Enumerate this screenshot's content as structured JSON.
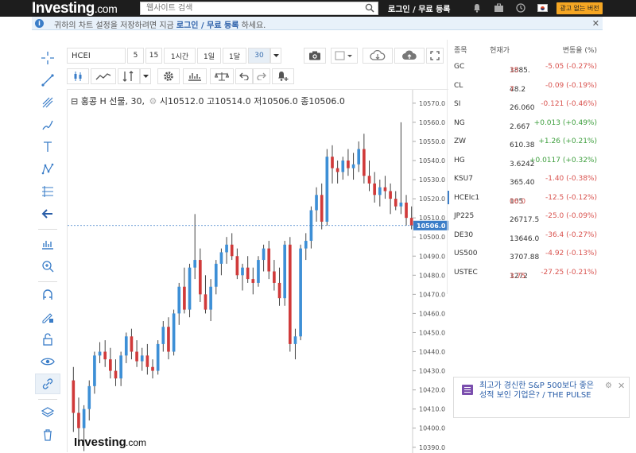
{
  "topbar": {
    "logo_main": "Investing",
    "logo_suffix": ".com",
    "search_placeholder": "웹사이트 검색",
    "login_text": "로그인 / 무료 등록",
    "premium_label": "광고 없는 버전"
  },
  "notice": {
    "text_before": "귀하의 차트 설정을 저장하려면 지금 ",
    "link": "로그인 / 무료 등록",
    "text_after": " 하세요."
  },
  "toolbar": {
    "symbol": "HCEI",
    "intervals": [
      "5",
      "15",
      "1시간",
      "1일",
      "1달",
      "30"
    ],
    "selected_interval": "30"
  },
  "chart": {
    "legend_name": "홍콩 H 선물, 30,",
    "open_label": "시",
    "open_value": "10512.0",
    "high_label": "고",
    "high_value": "10514.0",
    "low_label": "저",
    "low_value": "10506.0",
    "close_label": "종",
    "close_value": "10506.0",
    "last_price_label": "10506.0",
    "watermark_main": "Investing",
    "watermark_suffix": ".com",
    "up_color": "#3d8fd6",
    "down_color": "#d03a3a"
  },
  "chart_data": {
    "type": "candlestick",
    "title": "홍콩 H 선물, 30,",
    "ylim": [
      10387,
      10577
    ],
    "yticks": [
      10390,
      10400,
      10410,
      10420,
      10430,
      10440,
      10450,
      10460,
      10470,
      10480,
      10490,
      10500,
      10510,
      10520,
      10530,
      10540,
      10550,
      10560,
      10570
    ],
    "last_price": 10506.0,
    "candles": [
      [
        10425,
        10432,
        10398,
        10408
      ],
      [
        10408,
        10416,
        10392,
        10400
      ],
      [
        10400,
        10412,
        10388,
        10410
      ],
      [
        10410,
        10425,
        10404,
        10422
      ],
      [
        10422,
        10440,
        10418,
        10438
      ],
      [
        10438,
        10445,
        10434,
        10440
      ],
      [
        10440,
        10446,
        10432,
        10436
      ],
      [
        10436,
        10442,
        10426,
        10430
      ],
      [
        10430,
        10436,
        10422,
        10426
      ],
      [
        10426,
        10440,
        10422,
        10438
      ],
      [
        10438,
        10450,
        10434,
        10448
      ],
      [
        10448,
        10452,
        10436,
        10440
      ],
      [
        10440,
        10446,
        10432,
        10435
      ],
      [
        10435,
        10442,
        10430,
        10438
      ],
      [
        10438,
        10444,
        10428,
        10432
      ],
      [
        10432,
        10436,
        10426,
        10430
      ],
      [
        10430,
        10446,
        10428,
        10444
      ],
      [
        10444,
        10456,
        10440,
        10453
      ],
      [
        10453,
        10458,
        10436,
        10440
      ],
      [
        10440,
        10462,
        10438,
        10460
      ],
      [
        10460,
        10476,
        10454,
        10474
      ],
      [
        10474,
        10484,
        10460,
        10462
      ],
      [
        10462,
        10486,
        10458,
        10484
      ],
      [
        10484,
        10512,
        10478,
        10488
      ],
      [
        10488,
        10494,
        10466,
        10470
      ],
      [
        10470,
        10480,
        10460,
        10462
      ],
      [
        10462,
        10478,
        10456,
        10474
      ],
      [
        10474,
        10488,
        10470,
        10486
      ],
      [
        10486,
        10494,
        10480,
        10492
      ],
      [
        10492,
        10500,
        10486,
        10496
      ],
      [
        10496,
        10502,
        10488,
        10490
      ],
      [
        10490,
        10494,
        10478,
        10480
      ],
      [
        10480,
        10486,
        10472,
        10484
      ],
      [
        10484,
        10490,
        10476,
        10478
      ],
      [
        10478,
        10484,
        10470,
        10476
      ],
      [
        10476,
        10490,
        10474,
        10488
      ],
      [
        10488,
        10496,
        10482,
        10494
      ],
      [
        10494,
        10498,
        10478,
        10482
      ],
      [
        10482,
        10488,
        10472,
        10476
      ],
      [
        10476,
        10484,
        10464,
        10468
      ],
      [
        10468,
        10498,
        10464,
        10496
      ],
      [
        10496,
        10500,
        10440,
        10444
      ],
      [
        10444,
        10452,
        10436,
        10448
      ],
      [
        10448,
        10496,
        10446,
        10494
      ],
      [
        10494,
        10502,
        10488,
        10498
      ],
      [
        10498,
        10516,
        10494,
        10514
      ],
      [
        10514,
        10526,
        10508,
        10522
      ],
      [
        10522,
        10528,
        10504,
        10508
      ],
      [
        10508,
        10546,
        10506,
        10542
      ],
      [
        10542,
        10548,
        10528,
        10536
      ],
      [
        10536,
        10540,
        10528,
        10534
      ],
      [
        10534,
        10542,
        10530,
        10540
      ],
      [
        10540,
        10546,
        10532,
        10536
      ],
      [
        10536,
        10544,
        10530,
        10538
      ],
      [
        10538,
        10550,
        10534,
        10546
      ],
      [
        10546,
        10554,
        10528,
        10532
      ],
      [
        10532,
        10540,
        10524,
        10528
      ],
      [
        10528,
        10534,
        10518,
        10522
      ],
      [
        10522,
        10530,
        10516,
        10526
      ],
      [
        10526,
        10532,
        10520,
        10524
      ],
      [
        10524,
        10528,
        10512,
        10520
      ],
      [
        10520,
        10524,
        10514,
        10516
      ],
      [
        10516,
        10560,
        10512,
        10518
      ],
      [
        10518,
        10522,
        10506,
        10510
      ],
      [
        10510,
        10516,
        10504,
        10506
      ]
    ]
  },
  "markets": {
    "header": {
      "name": "종목",
      "price": "현재가",
      "change": "변동율 (%)"
    },
    "rows": [
      {
        "name": "GC",
        "price_main": "1885.",
        "price_hl": "35",
        "change": "-5.05 (-0.27%)",
        "dir": "neg"
      },
      {
        "name": "CL",
        "price_main": "48.2",
        "price_hl": "7",
        "change": "-0.09 (-0.19%)",
        "dir": "neg"
      },
      {
        "name": "SI",
        "price_main": "26.060",
        "price_hl": "",
        "change": "-0.121 (-0.46%)",
        "dir": "neg"
      },
      {
        "name": "NG",
        "price_main": "2.667",
        "price_hl": "",
        "change": "+0.013 (+0.49%)",
        "dir": "pos"
      },
      {
        "name": "ZW",
        "price_main": "610.38",
        "price_hl": "",
        "change": "+1.26 (+0.21%)",
        "dir": "pos"
      },
      {
        "name": "HG",
        "price_main": "3.6242",
        "price_hl": "",
        "change": "+0.0117 (+0.32%)",
        "dir": "pos"
      },
      {
        "name": "KSU7",
        "price_main": "365.40",
        "price_hl": "",
        "change": "-1.40 (-0.38%)",
        "dir": "neg"
      },
      {
        "name": "HCEIc1",
        "price_main": "105",
        "price_hl": "06.0",
        "change": "-12.5 (-0.12%)",
        "dir": "neg"
      },
      {
        "name": "JP225",
        "price_main": "26717.5",
        "price_hl": "",
        "change": "-25.0 (-0.09%)",
        "dir": "neg"
      },
      {
        "name": "DE30",
        "price_main": "13646.0",
        "price_hl": "",
        "change": "-36.4 (-0.27%)",
        "dir": "neg"
      },
      {
        "name": "US500",
        "price_main": "3707.88",
        "price_hl": "",
        "change": "-4.92 (-0.13%)",
        "dir": "neg"
      },
      {
        "name": "USTEC",
        "price_main": "1272",
        "price_hl": "3.75",
        "change": "-27.25 (-0.21%)",
        "dir": "neg"
      }
    ]
  },
  "article": {
    "title": "최고가 경신한 S&P 500보다 좋은 성적 보인 기업은? / THE PULSE"
  }
}
